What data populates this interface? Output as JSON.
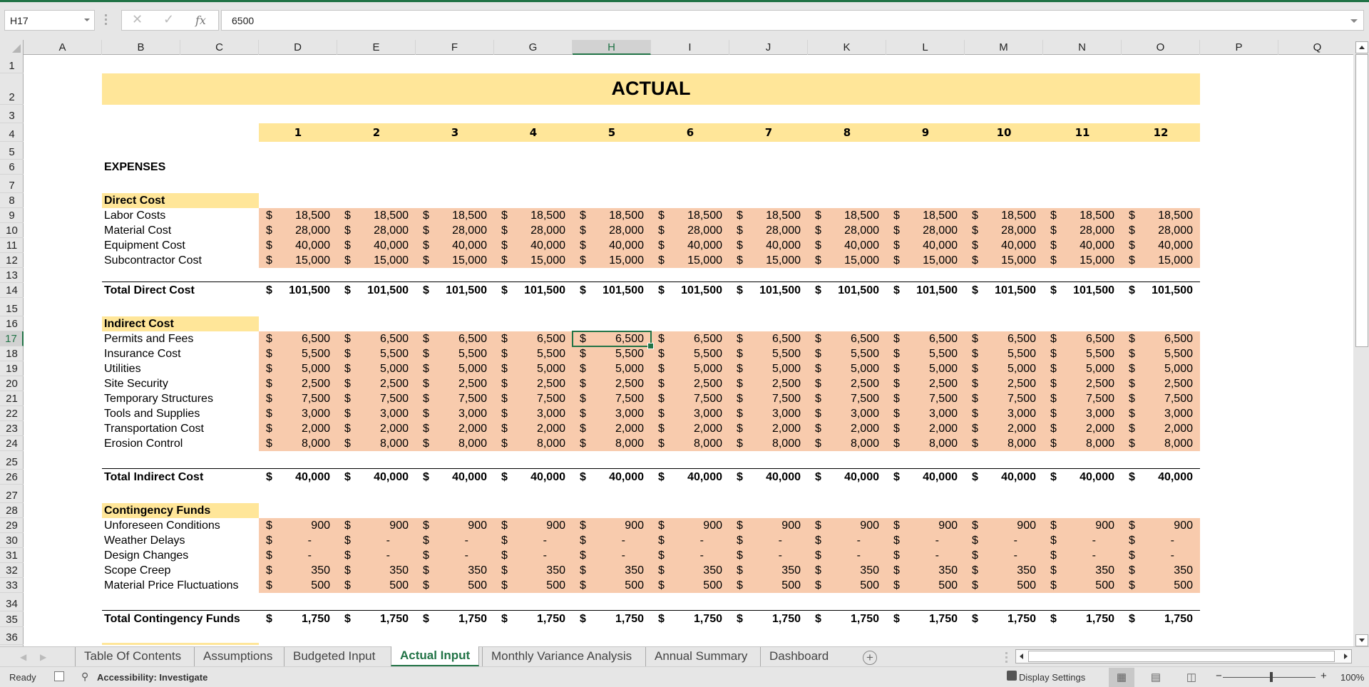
{
  "formula_bar": {
    "name_box": "H17",
    "cancel_icon": "✕",
    "enter_icon": "✓",
    "fx_label": "fx",
    "value": "6500"
  },
  "columns": [
    "A",
    "B",
    "C",
    "D",
    "E",
    "F",
    "G",
    "H",
    "I",
    "J",
    "K",
    "L",
    "M",
    "N",
    "O",
    "P",
    "Q"
  ],
  "selected_column": "H",
  "selected_row": 17,
  "rows": [
    "1",
    "2",
    "3",
    "4",
    "5",
    "6",
    "7",
    "8",
    "9",
    "10",
    "11",
    "12",
    "13",
    "14",
    "15",
    "16",
    "17",
    "18",
    "19",
    "20",
    "21",
    "22",
    "23",
    "24",
    "25",
    "26",
    "27",
    "28",
    "29",
    "30",
    "31",
    "32",
    "33",
    "34",
    "35",
    "36"
  ],
  "sheet": {
    "title": "ACTUAL",
    "months": [
      "1",
      "2",
      "3",
      "4",
      "5",
      "6",
      "7",
      "8",
      "9",
      "10",
      "11",
      "12"
    ],
    "expenses_label": "EXPENSES",
    "currency": "$",
    "sections": [
      {
        "header": "Direct Cost",
        "items": [
          {
            "label": "Labor Costs",
            "values": [
              "18,500",
              "18,500",
              "18,500",
              "18,500",
              "18,500",
              "18,500",
              "18,500",
              "18,500",
              "18,500",
              "18,500",
              "18,500",
              "18,500"
            ]
          },
          {
            "label": "Material Cost",
            "values": [
              "28,000",
              "28,000",
              "28,000",
              "28,000",
              "28,000",
              "28,000",
              "28,000",
              "28,000",
              "28,000",
              "28,000",
              "28,000",
              "28,000"
            ]
          },
          {
            "label": "Equipment Cost",
            "values": [
              "40,000",
              "40,000",
              "40,000",
              "40,000",
              "40,000",
              "40,000",
              "40,000",
              "40,000",
              "40,000",
              "40,000",
              "40,000",
              "40,000"
            ]
          },
          {
            "label": "Subcontractor Cost",
            "values": [
              "15,000",
              "15,000",
              "15,000",
              "15,000",
              "15,000",
              "15,000",
              "15,000",
              "15,000",
              "15,000",
              "15,000",
              "15,000",
              "15,000"
            ]
          }
        ],
        "total_label": "Total Direct Cost",
        "total_values": [
          "101,500",
          "101,500",
          "101,500",
          "101,500",
          "101,500",
          "101,500",
          "101,500",
          "101,500",
          "101,500",
          "101,500",
          "101,500",
          "101,500"
        ]
      },
      {
        "header": "Indirect Cost",
        "items": [
          {
            "label": "Permits and Fees",
            "values": [
              "6,500",
              "6,500",
              "6,500",
              "6,500",
              "6,500",
              "6,500",
              "6,500",
              "6,500",
              "6,500",
              "6,500",
              "6,500",
              "6,500"
            ]
          },
          {
            "label": "Insurance Cost",
            "values": [
              "5,500",
              "5,500",
              "5,500",
              "5,500",
              "5,500",
              "5,500",
              "5,500",
              "5,500",
              "5,500",
              "5,500",
              "5,500",
              "5,500"
            ]
          },
          {
            "label": "Utilities",
            "values": [
              "5,000",
              "5,000",
              "5,000",
              "5,000",
              "5,000",
              "5,000",
              "5,000",
              "5,000",
              "5,000",
              "5,000",
              "5,000",
              "5,000"
            ]
          },
          {
            "label": "Site Security",
            "values": [
              "2,500",
              "2,500",
              "2,500",
              "2,500",
              "2,500",
              "2,500",
              "2,500",
              "2,500",
              "2,500",
              "2,500",
              "2,500",
              "2,500"
            ]
          },
          {
            "label": "Temporary Structures",
            "values": [
              "7,500",
              "7,500",
              "7,500",
              "7,500",
              "7,500",
              "7,500",
              "7,500",
              "7,500",
              "7,500",
              "7,500",
              "7,500",
              "7,500"
            ]
          },
          {
            "label": "Tools and Supplies",
            "values": [
              "3,000",
              "3,000",
              "3,000",
              "3,000",
              "3,000",
              "3,000",
              "3,000",
              "3,000",
              "3,000",
              "3,000",
              "3,000",
              "3,000"
            ]
          },
          {
            "label": "Transportation Cost",
            "values": [
              "2,000",
              "2,000",
              "2,000",
              "2,000",
              "2,000",
              "2,000",
              "2,000",
              "2,000",
              "2,000",
              "2,000",
              "2,000",
              "2,000"
            ]
          },
          {
            "label": "Erosion Control",
            "values": [
              "8,000",
              "8,000",
              "8,000",
              "8,000",
              "8,000",
              "8,000",
              "8,000",
              "8,000",
              "8,000",
              "8,000",
              "8,000",
              "8,000"
            ]
          }
        ],
        "total_label": "Total Indirect Cost",
        "total_values": [
          "40,000",
          "40,000",
          "40,000",
          "40,000",
          "40,000",
          "40,000",
          "40,000",
          "40,000",
          "40,000",
          "40,000",
          "40,000",
          "40,000"
        ]
      },
      {
        "header": "Contingency Funds",
        "items": [
          {
            "label": "Unforeseen Conditions",
            "values": [
              "900",
              "900",
              "900",
              "900",
              "900",
              "900",
              "900",
              "900",
              "900",
              "900",
              "900",
              "900"
            ]
          },
          {
            "label": "Weather Delays",
            "values": [
              "-",
              "-",
              "-",
              "-",
              "-",
              "-",
              "-",
              "-",
              "-",
              "-",
              "-",
              "-"
            ]
          },
          {
            "label": "Design Changes",
            "values": [
              "-",
              "-",
              "-",
              "-",
              "-",
              "-",
              "-",
              "-",
              "-",
              "-",
              "-",
              "-"
            ]
          },
          {
            "label": "Scope Creep",
            "values": [
              "350",
              "350",
              "350",
              "350",
              "350",
              "350",
              "350",
              "350",
              "350",
              "350",
              "350",
              "350"
            ]
          },
          {
            "label": "Material Price Fluctuations",
            "values": [
              "500",
              "500",
              "500",
              "500",
              "500",
              "500",
              "500",
              "500",
              "500",
              "500",
              "500",
              "500"
            ]
          }
        ],
        "total_label": "Total Contingency Funds",
        "total_values": [
          "1,750",
          "1,750",
          "1,750",
          "1,750",
          "1,750",
          "1,750",
          "1,750",
          "1,750",
          "1,750",
          "1,750",
          "1,750",
          "1,750"
        ]
      }
    ]
  },
  "tabs": [
    {
      "label": "Table Of Contents",
      "active": false
    },
    {
      "label": "Assumptions",
      "active": false
    },
    {
      "label": "Budgeted Input",
      "active": false
    },
    {
      "label": "Actual Input",
      "active": true
    },
    {
      "label": "Monthly Variance Analysis",
      "active": false
    },
    {
      "label": "Annual Summary",
      "active": false
    },
    {
      "label": "Dashboard",
      "active": false
    }
  ],
  "status_bar": {
    "ready": "Ready",
    "accessibility": "Accessibility: Investigate",
    "display_settings": "Display Settings",
    "zoom_minus": "−",
    "zoom_plus": "+",
    "zoom_level": "100%"
  },
  "colors": {
    "accent": "#217346",
    "header_fill": "#ffe699",
    "data_fill": "#f8cbad"
  }
}
